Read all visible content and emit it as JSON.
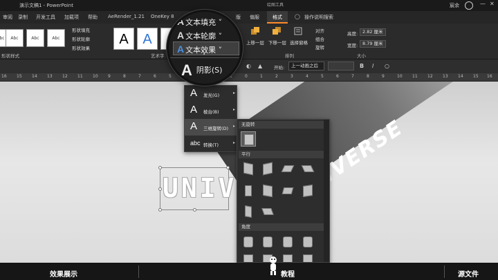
{
  "window": {
    "title": "演示文稿1 - PowerPoint",
    "context_tab": "绘图工具",
    "user": "宸余",
    "min": "—",
    "max": "☐",
    "close": "✕"
  },
  "tabs": [
    {
      "label": "审阅"
    },
    {
      "label": "录制"
    },
    {
      "label": "开发工具"
    },
    {
      "label": "加载项"
    },
    {
      "label": "帮助"
    },
    {
      "label": "AeRender_1.21"
    },
    {
      "label": "OneKey 8"
    },
    {
      "label": "版"
    },
    {
      "label": "偏服"
    },
    {
      "label": "格式"
    },
    {
      "label": "操作说明搜索"
    }
  ],
  "ribbon": {
    "shape_styles": {
      "swatch_label": "Abc",
      "fill": "形状填充",
      "outline": "形状轮廓",
      "effect": "形状效果",
      "group_label": "形状样式"
    },
    "wordart": {
      "letter": "A",
      "group_label": "艺术字"
    },
    "arrange": {
      "bring_forward": "上移一层",
      "send_backward": "下移一层",
      "selection_pane": "选择窗格",
      "align": "对齐",
      "group": "组合",
      "rotate": "旋转",
      "group_label": "排列"
    },
    "size": {
      "height_label": "高度:",
      "height_value": "2.82 厘米",
      "width_label": "宽度:",
      "width_value": "8.79 厘米",
      "group_label": "大小"
    }
  },
  "format_bar": {
    "start_label": "开始:",
    "animation_value": "上一动画之后",
    "bold": "B",
    "italic": "I"
  },
  "ruler": {
    "ticks": [
      "16",
      "15",
      "14",
      "13",
      "12",
      "11",
      "10",
      "9",
      "8",
      "7",
      "6",
      "5",
      "4",
      "3",
      "2",
      "1",
      "0",
      "1",
      "2",
      "3",
      "4",
      "5",
      "6",
      "7",
      "8",
      "9",
      "10",
      "11",
      "12",
      "13",
      "14",
      "15",
      "16"
    ]
  },
  "canvas": {
    "main_text": "UNIVE",
    "ribbon_text": "IVERSE"
  },
  "magnifier": {
    "text_fill": "文本填充",
    "text_outline": "文本轮廓",
    "text_effects": "文本效果",
    "shadow": "阴影(S)",
    "glyph": "A"
  },
  "effects_menu": {
    "items": [
      {
        "glyph": "A",
        "label": "发光(G)"
      },
      {
        "glyph": "A",
        "label": "棱台(B)"
      },
      {
        "glyph": "A",
        "label": "三维旋转(D)"
      },
      {
        "glyph": "abc",
        "label": "转换(T)"
      }
    ]
  },
  "rotation_gallery": {
    "none": "无旋转",
    "parallel": "平行",
    "perspective": "角度"
  },
  "bottom_bar": {
    "left": "效果展示",
    "center": "教程",
    "right": "源文件"
  }
}
